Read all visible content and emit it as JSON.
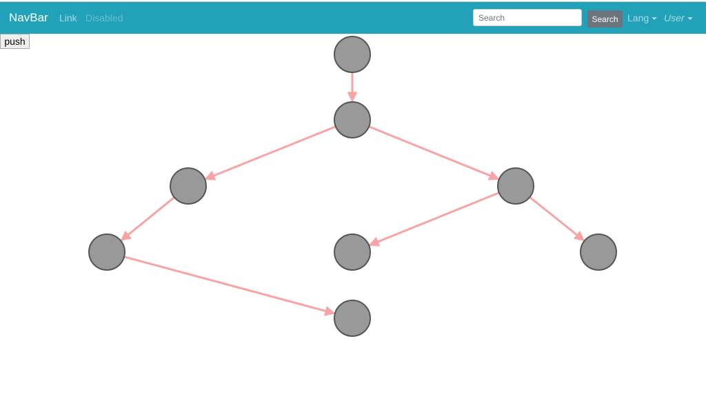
{
  "navbar": {
    "brand": "NavBar",
    "link": "Link",
    "disabled": "Disabled",
    "search_placeholder": "Search",
    "search_button": "Search",
    "lang": "Lang",
    "user": "User",
    "color": "#22a2b8"
  },
  "push_button": "push",
  "graph": {
    "node_color": "#999999",
    "node_stroke": "#555555",
    "edge_color": "#f9a3a4",
    "nodes": [
      {
        "id": 0
      },
      {
        "id": 1
      },
      {
        "id": 2
      },
      {
        "id": 3
      },
      {
        "id": 4
      },
      {
        "id": 5
      },
      {
        "id": 6
      },
      {
        "id": 7
      }
    ],
    "edges": [
      [
        0,
        1
      ],
      [
        1,
        2
      ],
      [
        1,
        3
      ],
      [
        2,
        4
      ],
      [
        3,
        5
      ],
      [
        3,
        6
      ],
      [
        4,
        7
      ]
    ]
  }
}
